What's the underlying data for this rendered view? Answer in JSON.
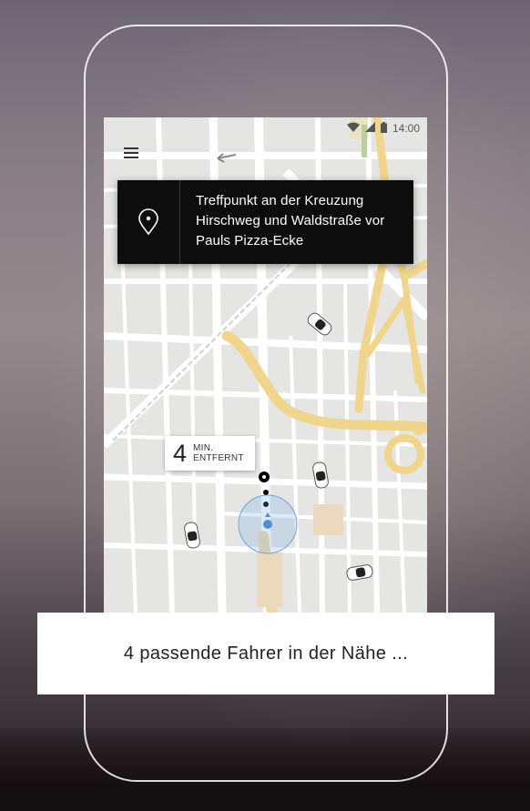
{
  "status_bar": {
    "time": "14:00"
  },
  "pickup_card": {
    "text_line1": "Treffpunkt an der Kreuzung",
    "text_line2": "Hirschweg und Waldstraße vor",
    "text_line3": "Pauls Pizza-Ecke"
  },
  "eta": {
    "minutes": "4",
    "unit_line1": "MIN.",
    "unit_line2": "ENTFERNT"
  },
  "status_banner": {
    "text": "4 passende Fahrer in der Nähe ..."
  },
  "colors": {
    "map_background": "#e6e6e4",
    "major_road": "#f0d58a",
    "card_background": "#0d0d0d",
    "location_dot": "#4a90d9"
  },
  "icons": {
    "menu": "hamburger-menu-icon",
    "pin": "location-pin-icon",
    "wifi": "wifi-icon",
    "signal": "signal-icon",
    "battery": "battery-icon"
  }
}
